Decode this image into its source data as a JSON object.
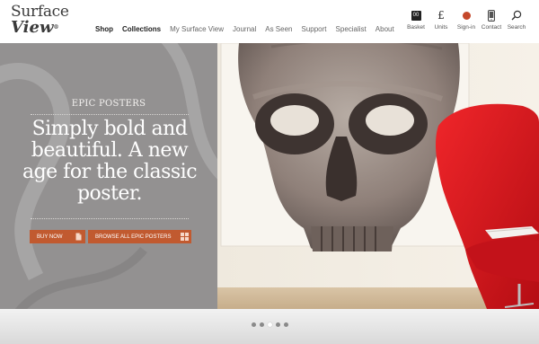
{
  "brand": {
    "line1": "Surface",
    "line2": "View",
    "mark": "®"
  },
  "nav": [
    {
      "label": "Shop",
      "bold": true
    },
    {
      "label": "Collections",
      "bold": true
    },
    {
      "label": "My Surface View",
      "bold": false
    },
    {
      "label": "Journal",
      "bold": false
    },
    {
      "label": "As Seen",
      "bold": false
    },
    {
      "label": "Support",
      "bold": false
    },
    {
      "label": "Specialist",
      "bold": false
    },
    {
      "label": "About",
      "bold": false
    }
  ],
  "utility": {
    "basket": {
      "label": "Basket",
      "count": "00",
      "icon": "basket-icon"
    },
    "units": {
      "label": "Units",
      "symbol": "£",
      "icon": "currency-icon"
    },
    "signin": {
      "label": "Sign-in",
      "icon": "sign-in-icon"
    },
    "contact": {
      "label": "Contact",
      "icon": "phone-icon"
    },
    "search": {
      "label": "Search",
      "icon": "search-icon"
    }
  },
  "hero": {
    "kicker": "EPIC POSTERS",
    "headline": "Simply bold and beautiful. A new age for the classic poster.",
    "buy_label": "BUY NOW",
    "browse_label": "BROWSE ALL EPIC POSTERS"
  },
  "carousel": {
    "slides": 5,
    "active": 3
  },
  "colors": {
    "accent": "#c15a30",
    "panel": "#939191",
    "chair": "#d8171d"
  }
}
